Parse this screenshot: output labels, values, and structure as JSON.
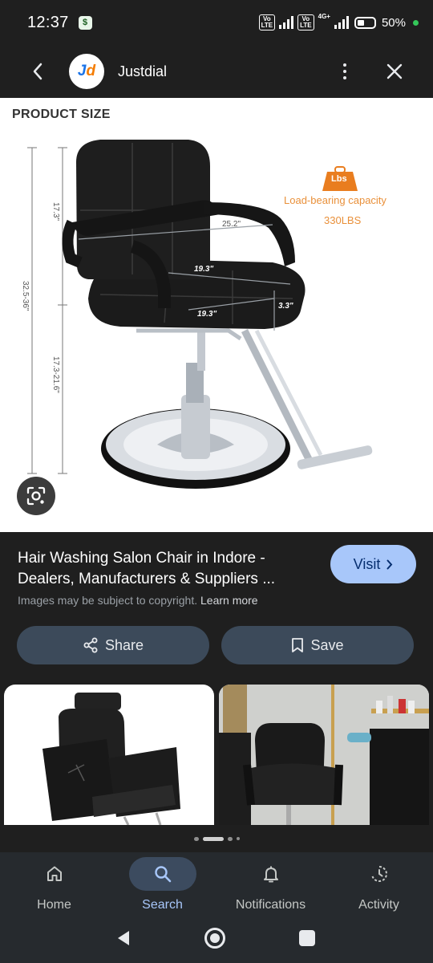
{
  "status_bar": {
    "time": "12:37",
    "network_1": "Vo\nLTE",
    "network_2": "Vo\nLTE",
    "network_type": "4G+",
    "battery": "50%"
  },
  "header": {
    "logo_text_j": "J",
    "logo_text_d": "d",
    "site_name": "Justdial",
    "icons": {
      "back": "chevron-left-icon",
      "more": "kebab-icon",
      "close": "close-icon"
    }
  },
  "image": {
    "heading": "PRODUCT SIZE",
    "weight_badge": "Lbs",
    "capacity_label": "Load-bearing capacity",
    "capacity_value": "330LBS",
    "dimensions": {
      "backrest_height": "17.3\"",
      "total_height": "32.5-36\"",
      "seat_height": "17.3-21.6\"",
      "arm_width": "25.2\"",
      "seat_width": "19.3\"",
      "seat_depth": "19.3\"",
      "seat_thickness": "3.3\""
    }
  },
  "result": {
    "title": "Hair Washing Salon Chair in Indore - Dealers, Manufacturers & Suppliers ...",
    "copyright": "Images may be subject to copyright.",
    "learn_more": "Learn more",
    "visit_label": "Visit",
    "share_label": "Share",
    "save_label": "Save"
  },
  "bottom_nav": {
    "items": [
      {
        "label": "Home",
        "icon": "home-icon",
        "active": false
      },
      {
        "label": "Search",
        "icon": "search-icon",
        "active": true
      },
      {
        "label": "Notifications",
        "icon": "bell-icon",
        "active": false
      },
      {
        "label": "Activity",
        "icon": "history-icon",
        "active": false
      }
    ]
  },
  "colors": {
    "background": "#1f1f1f",
    "accent": "#a8c7fa",
    "button": "#3c4a5a",
    "capacity_orange": "#e9903a"
  }
}
